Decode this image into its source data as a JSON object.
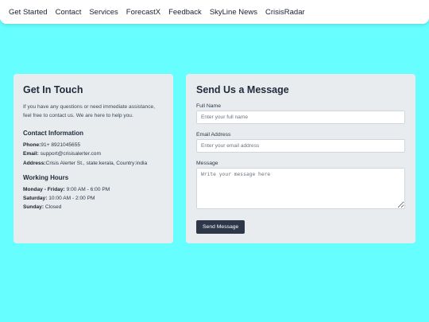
{
  "nav": {
    "items": [
      "Get Started",
      "Contact",
      "Services",
      "ForecastX",
      "Feedback",
      "SkyLine News",
      "CrisisRadar"
    ]
  },
  "contact_card": {
    "title": "Get In Touch",
    "intro": "If you have any questions or need immediate assistance, feel free to contact us. We are here to help you.",
    "info_title": "Contact Information",
    "phone_label": "Phone:",
    "phone_value": "91+ 8921045655",
    "email_label": "Email:",
    "email_value": " support@crisisalerter.com",
    "address_label": "Address:",
    "address_value": "Crisis Alerter St., state:kerala, Country:india",
    "hours_title": "Working Hours",
    "weekday_label": "Monday - Friday:",
    "weekday_value": " 9:00 AM - 6:00 PM",
    "saturday_label": "Saturday:",
    "saturday_value": " 10:00 AM - 2:00 PM",
    "sunday_label": "Sunday:",
    "sunday_value": " Closed"
  },
  "form": {
    "title": "Send Us a Message",
    "name_label": "Full Name",
    "name_placeholder": "Enter your full name",
    "name_value": "",
    "email_label": "Email Address",
    "email_placeholder": "Enter your email address",
    "email_value": "",
    "message_label": "Message",
    "message_placeholder": "Write your message here",
    "message_value": "",
    "submit_label": "Send Message"
  },
  "colors": {
    "background": "#66feff",
    "card": "#e9ecee",
    "button": "#2d3748"
  }
}
